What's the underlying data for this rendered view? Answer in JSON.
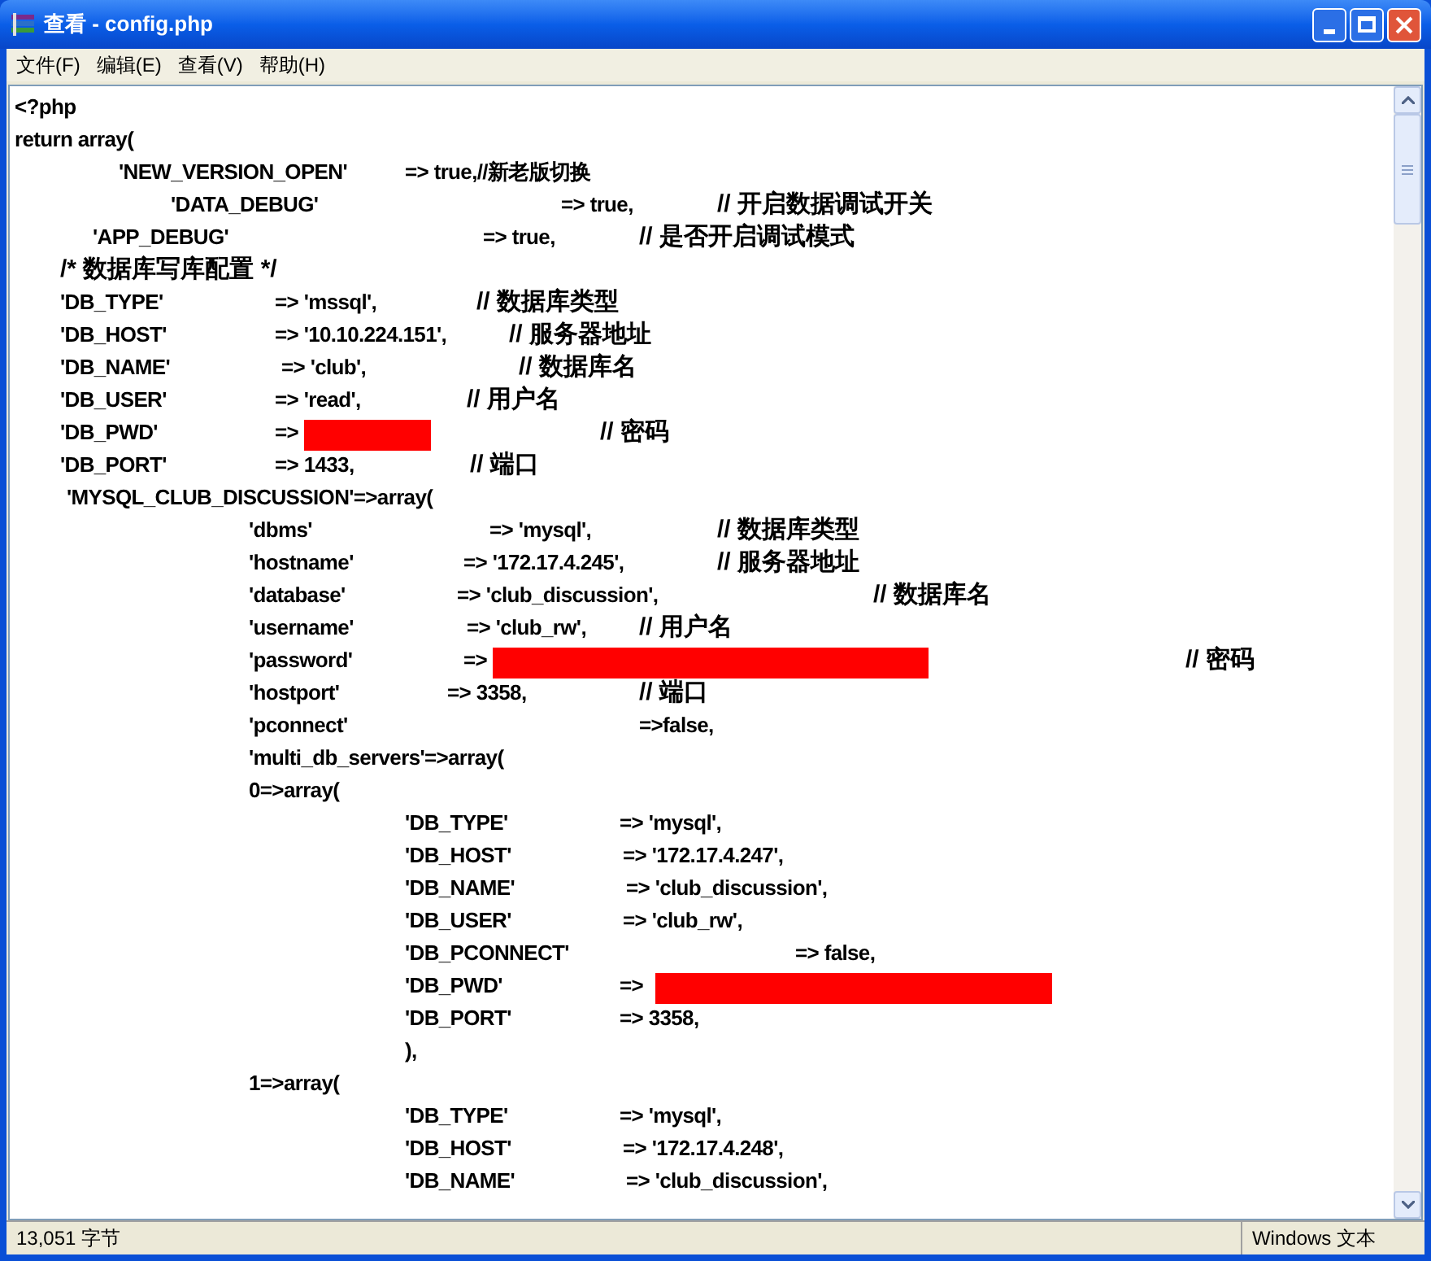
{
  "window": {
    "title": "查看 - config.php"
  },
  "menu": [
    "文件(F)",
    "编辑(E)",
    "查看(V)",
    "帮助(H)"
  ],
  "lines": [
    [
      {
        "kind": "code",
        "text": "<?php"
      }
    ],
    [
      {
        "kind": "code",
        "text": "return array("
      }
    ],
    [
      {
        "kind": "code",
        "text": "'NEW_VERSION_OPEN'"
      },
      {
        "kind": "code",
        "text": "=> true,//新老版切换"
      }
    ],
    [
      {
        "kind": "code",
        "text": "'DATA_DEBUG'"
      },
      {
        "kind": "code",
        "text": "=> true,"
      },
      {
        "kind": "comment",
        "text": "// 开启数据调试开关"
      }
    ],
    [
      {
        "kind": "code",
        "text": "'APP_DEBUG'"
      },
      {
        "kind": "code",
        "text": "=> true,"
      },
      {
        "kind": "comment",
        "text": "// 是否开启调试模式"
      }
    ],
    [
      {
        "kind": "comment",
        "text": "/* 数据库写库配置 */"
      }
    ],
    [
      {
        "kind": "code",
        "text": "'DB_TYPE'"
      },
      {
        "kind": "code",
        "text": "=> 'mssql',"
      },
      {
        "kind": "comment",
        "text": "// 数据库类型"
      }
    ],
    [
      {
        "kind": "code",
        "text": "'DB_HOST'"
      },
      {
        "kind": "code",
        "text": "=> '10.10.224.151',"
      },
      {
        "kind": "comment",
        "text": "// 服务器地址"
      }
    ],
    [
      {
        "kind": "code",
        "text": "'DB_NAME'"
      },
      {
        "kind": "code",
        "text": "=> 'club',"
      },
      {
        "kind": "comment",
        "text": "// 数据库名"
      }
    ],
    [
      {
        "kind": "code",
        "text": "'DB_USER'"
      },
      {
        "kind": "code",
        "text": "=> 'read',"
      },
      {
        "kind": "comment",
        "text": "// 用户名"
      }
    ],
    [
      {
        "kind": "code",
        "text": "'DB_PWD'"
      },
      {
        "kind": "code",
        "text": "=>"
      },
      {
        "kind": "redacted"
      },
      {
        "kind": "comment",
        "text": "// 密码"
      }
    ],
    [
      {
        "kind": "code",
        "text": "'DB_PORT'"
      },
      {
        "kind": "code",
        "text": "=> 1433,"
      },
      {
        "kind": "comment",
        "text": "// 端口"
      }
    ],
    [
      {
        "kind": "code",
        "text": "'MYSQL_CLUB_DISCUSSION'=>array("
      }
    ],
    [
      {
        "kind": "code",
        "text": "'dbms'"
      },
      {
        "kind": "code",
        "text": "=> 'mysql',"
      },
      {
        "kind": "comment",
        "text": "// 数据库类型"
      }
    ],
    [
      {
        "kind": "code",
        "text": "'hostname'"
      },
      {
        "kind": "code",
        "text": "=> '172.17.4.245',"
      },
      {
        "kind": "comment",
        "text": "// 服务器地址"
      }
    ],
    [
      {
        "kind": "code",
        "text": "'database'"
      },
      {
        "kind": "code",
        "text": "=> 'club_discussion',"
      },
      {
        "kind": "comment",
        "text": "// 数据库名"
      }
    ],
    [
      {
        "kind": "code",
        "text": "'username'"
      },
      {
        "kind": "code",
        "text": "=> 'club_rw',"
      },
      {
        "kind": "comment",
        "text": "// 用户名"
      }
    ],
    [
      {
        "kind": "code",
        "text": "'password'"
      },
      {
        "kind": "code",
        "text": "=>"
      },
      {
        "kind": "redacted"
      },
      {
        "kind": "comment",
        "text": "// 密码"
      }
    ],
    [
      {
        "kind": "code",
        "text": "'hostport'"
      },
      {
        "kind": "code",
        "text": "=> 3358,"
      },
      {
        "kind": "comment",
        "text": "// 端口"
      }
    ],
    [
      {
        "kind": "code",
        "text": "'pconnect'"
      },
      {
        "kind": "code",
        "text": "=>false,"
      }
    ],
    [
      {
        "kind": "code",
        "text": "'multi_db_servers'=>array("
      }
    ],
    [
      {
        "kind": "code",
        "text": "0=>array("
      }
    ],
    [
      {
        "kind": "code",
        "text": "'DB_TYPE'"
      },
      {
        "kind": "code",
        "text": "=> 'mysql',"
      }
    ],
    [
      {
        "kind": "code",
        "text": "'DB_HOST'"
      },
      {
        "kind": "code",
        "text": "=> '172.17.4.247',"
      }
    ],
    [
      {
        "kind": "code",
        "text": "'DB_NAME'"
      },
      {
        "kind": "code",
        "text": "=> 'club_discussion',"
      }
    ],
    [
      {
        "kind": "code",
        "text": "'DB_USER'"
      },
      {
        "kind": "code",
        "text": "=> 'club_rw',"
      }
    ],
    [
      {
        "kind": "code",
        "text": "'DB_PCONNECT'"
      },
      {
        "kind": "code",
        "text": "=> false,"
      }
    ],
    [
      {
        "kind": "code",
        "text": "'DB_PWD'"
      },
      {
        "kind": "code",
        "text": "=>"
      },
      {
        "kind": "redacted"
      }
    ],
    [
      {
        "kind": "code",
        "text": "'DB_PORT'"
      },
      {
        "kind": "code",
        "text": "=> 3358,"
      }
    ],
    [
      {
        "kind": "code",
        "text": "),"
      }
    ],
    [
      {
        "kind": "code",
        "text": "1=>array("
      }
    ],
    [
      {
        "kind": "code",
        "text": "'DB_TYPE'"
      },
      {
        "kind": "code",
        "text": "=> 'mysql',"
      }
    ],
    [
      {
        "kind": "code",
        "text": "'DB_HOST'"
      },
      {
        "kind": "code",
        "text": "=> '172.17.4.248',"
      }
    ],
    [
      {
        "kind": "code",
        "text": "'DB_NAME'"
      },
      {
        "kind": "code",
        "text": "=> 'club_discussion',"
      }
    ]
  ],
  "status_bar": {
    "size": "13,051 字节",
    "encoding": "Windows 文本"
  }
}
